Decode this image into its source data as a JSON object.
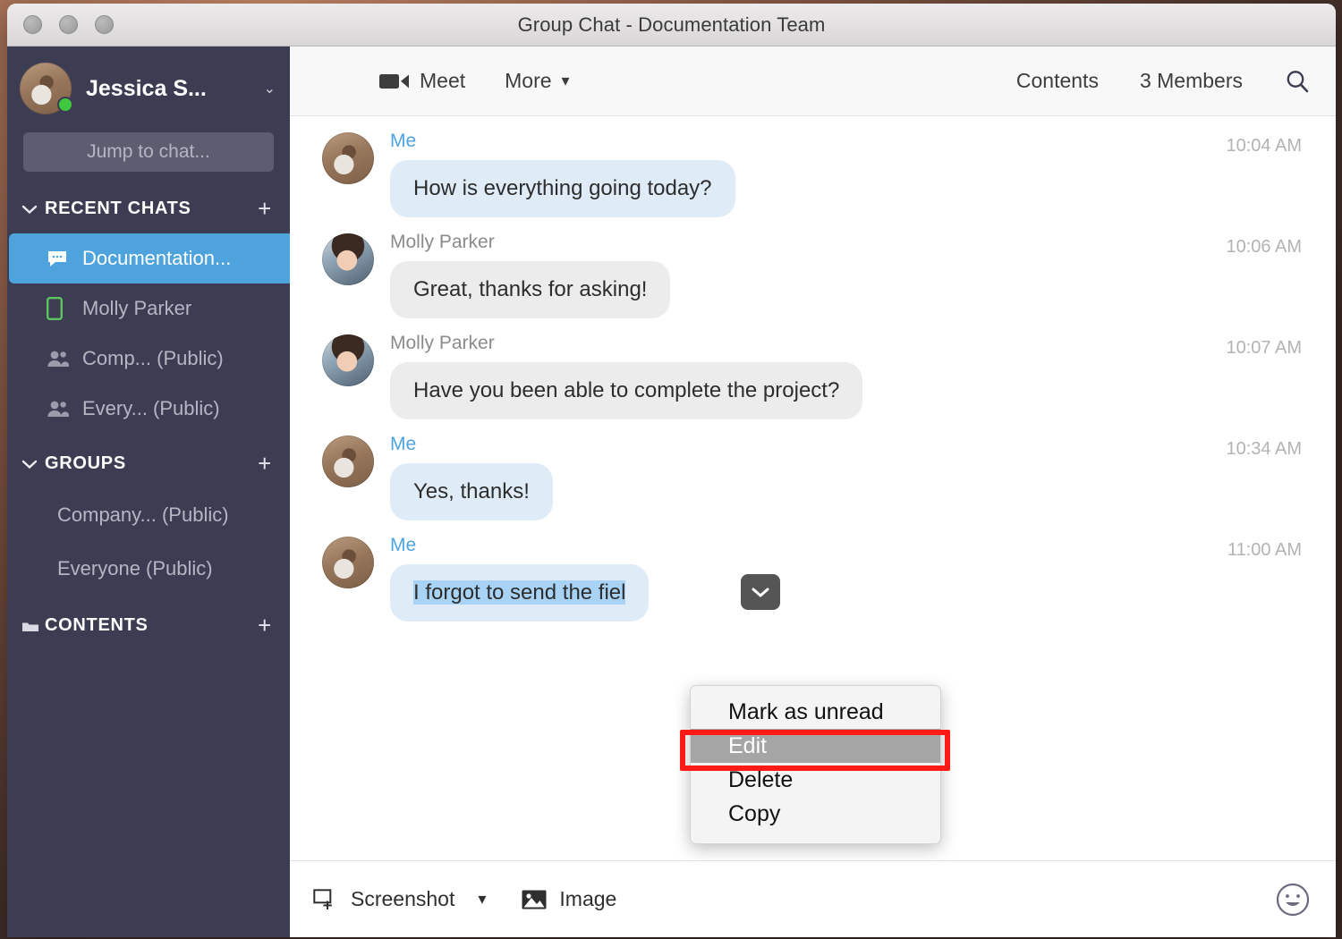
{
  "window": {
    "title": "Group Chat - Documentation Team",
    "traffic_lights": [
      "close-button",
      "minimize-button",
      "zoom-button"
    ]
  },
  "sidebar": {
    "profile": {
      "name": "Jessica S...",
      "presence": "online",
      "caret": "⌄"
    },
    "search": {
      "placeholder": "Jump to chat...",
      "value": ""
    },
    "sections": [
      {
        "id": "recent-chats",
        "label": "RECENT CHATS",
        "chevron": "∨",
        "plus": "+",
        "icon": "chevron-down-icon"
      },
      {
        "id": "groups",
        "label": "GROUPS",
        "chevron": "∨",
        "plus": "+",
        "icon": "chevron-down-icon"
      },
      {
        "id": "contents",
        "label": "CONTENTS",
        "chevron": "",
        "plus": "+",
        "icon": "folder-icon"
      }
    ],
    "recent_chats": [
      {
        "label": "Documentation...",
        "icon": "chat-bubble-icon",
        "selected": true
      },
      {
        "label": "Molly Parker",
        "icon": "mobile-phone-icon",
        "selected": false
      },
      {
        "label": "Comp... (Public)",
        "icon": "people-icon",
        "selected": false
      },
      {
        "label": "Every... (Public)",
        "icon": "people-icon",
        "selected": false
      }
    ],
    "groups": [
      {
        "label": "Company... (Public)"
      },
      {
        "label": "Everyone (Public)"
      }
    ],
    "colors": {
      "background": "#3c3d52",
      "selected": "#4fa3dd",
      "presence": "#3ec93e"
    }
  },
  "toolbar": {
    "meet_label": "Meet",
    "more_label": "More",
    "more_caret": "▾",
    "contents_label": "Contents",
    "members_label": "3 Members",
    "search_icon": "search-icon"
  },
  "messages": [
    {
      "sender": "Me",
      "self": true,
      "text": "How is everything going today?",
      "time": "10:04 AM",
      "avatar": "me"
    },
    {
      "sender": "Molly Parker",
      "self": false,
      "text": "Great, thanks for asking!",
      "time": "10:06 AM",
      "avatar": "molly"
    },
    {
      "sender": "Molly Parker",
      "self": false,
      "text": "Have you been able to complete the project?",
      "time": "10:07 AM",
      "avatar": "molly"
    },
    {
      "sender": "Me",
      "self": true,
      "text": "Yes, thanks!",
      "time": "10:34 AM",
      "avatar": "me"
    },
    {
      "sender": "Me",
      "self": true,
      "text": "I forgot to send the fiel",
      "time": "11:00 AM",
      "avatar": "me",
      "selected_text": true
    }
  ],
  "context_menu": {
    "items": [
      {
        "label": "Mark as unread",
        "highlighted": false
      },
      {
        "label": "Edit",
        "highlighted": true
      },
      {
        "label": "Delete",
        "highlighted": false
      },
      {
        "label": "Copy",
        "highlighted": false
      }
    ],
    "annotation_color": "#fc1b14",
    "highlight_color": "#a5a5a5"
  },
  "composer": {
    "screenshot_label": "Screenshot",
    "screenshot_caret": "▾",
    "image_label": "Image",
    "emoji_icon": "smiley-face-icon",
    "input_placeholder": ""
  }
}
